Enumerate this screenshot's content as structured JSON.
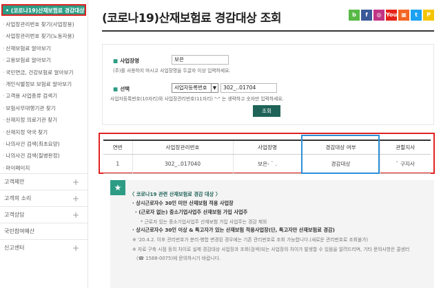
{
  "sidebar": {
    "active": "• (코로나19)산재보험료 경감대상 조회",
    "items": [
      "사업장관리번호 찾기(사업장용)",
      "사업장관리번호 찾기(노동자용)",
      "산재보험료 알아보기",
      "고용보험료 알아보기",
      "국민연금, 건강보험료 알아보기",
      "개인식별정보 보험료 알아보기",
      "고객용 사업종류 검색기",
      "보험사무대행기관 찾기",
      "산재지정 의료기관 찾기",
      "산재지정 약국 찾기",
      "나의사건 검색(최초요양)",
      "나의사건 검색(질병판정)",
      "마이페이지"
    ],
    "groups": [
      "고객제안",
      "고객의 소리",
      "고객상담",
      "국민참여예산",
      "신고센터"
    ]
  },
  "header": {
    "title": "(코로나19)산재보험료 경감대상 조회",
    "social": [
      {
        "label": "b",
        "color": "#58b947"
      },
      {
        "label": "f",
        "color": "#3b5998"
      },
      {
        "label": "◎",
        "color": "#c13584"
      },
      {
        "label": "You",
        "color": "#e62117"
      },
      {
        "label": "▦",
        "color": "#f26522"
      },
      {
        "label": "t",
        "color": "#1da1f2"
      },
      {
        "label": "P",
        "color": "#f5c400"
      }
    ]
  },
  "form": {
    "name_label": "사업장명",
    "name_value": "보은",
    "name_hint": "(주)를 사용하지 마시고 사업장명을 두글자 이상 입력하세요.",
    "select_label": "선택",
    "select_value": "사업자등록번호",
    "number_value": "302_..01704",
    "number_hint": "사업자등록번호(10자리)와 사업장관리번호(11자리) \"-\" 는 생략하고 숫자만 입력하세요.",
    "search_button": "조회"
  },
  "results": {
    "headers": [
      "연번",
      "사업장관리번호",
      "사업장명",
      "경감대상 여부",
      "관할지사"
    ],
    "rows": [
      [
        "1",
        "302_..017040",
        "보은- ` .",
        "경감대상",
        "` 구지사"
      ]
    ]
  },
  "notice": {
    "title": "〈 코로나19 관련 산재보험료 경감 대상 〉",
    "lines": [
      "· 상시근로자수 30인 미만 산재보험 적용 사업장",
      "· (근로자 없는) 중소기업사업주 산재보험 가입 사업주",
      "* 근로자 있는 중소기업사업주 산재보험 가입 사업주는 경감 제외",
      "· 상시근로자수 30인 이상 & 특고자가 있는 산재보험 적용사업장(단, 특고자만 산재보험료 경감)",
      "※ '20.4.2. 이후 관리번호가 분리·병합 변경된 경우에는 기존 관리번호로 조회 가능합니다.(새로운 관리번호로 조회불가)",
      "※ 자료 구축 시점 등의 차이로 실제 경감대상 사업장과 조회(검색)되는 사업장의 차이가 발생할 수 있음을 알려드리며, 기타 문의사항은 콜센터",
      "(☎ 1588-0075)에 문의하시기 바랍니다."
    ]
  }
}
